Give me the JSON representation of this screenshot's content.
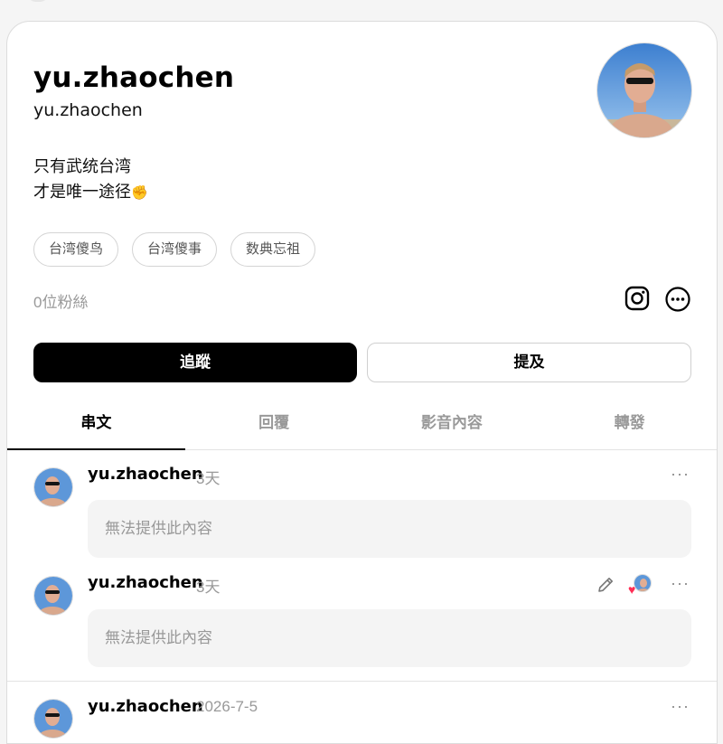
{
  "profile": {
    "display_name": "yu.zhaochen",
    "username": "yu.zhaochen",
    "bio_line1": "只有武统台湾",
    "bio_line2": "才是唯一途径",
    "bio_emoji": "✊",
    "tags": [
      "台湾傻鸟",
      "台湾傻事",
      "数典忘祖"
    ],
    "followers": "0位粉絲"
  },
  "actions": {
    "follow": "追蹤",
    "mention": "提及"
  },
  "tabs": [
    "串文",
    "回覆",
    "影音內容",
    "轉發"
  ],
  "posts": [
    {
      "user": "yu.zhaochen",
      "time": "3天",
      "content": "無法提供此內容",
      "more": "···"
    },
    {
      "user": "yu.zhaochen",
      "time": "3天",
      "content": "無法提供此內容",
      "more": "···"
    },
    {
      "user": "yu.zhaochen",
      "time": "2026-7-5",
      "more": "···"
    }
  ],
  "icons": {
    "instagram": "instagram-icon",
    "more": "more-circle-icon",
    "edit": "pencil-icon",
    "like": "heart-icon"
  },
  "colors": {
    "follow_bg": "#000000",
    "heart": "#ff2d55"
  }
}
